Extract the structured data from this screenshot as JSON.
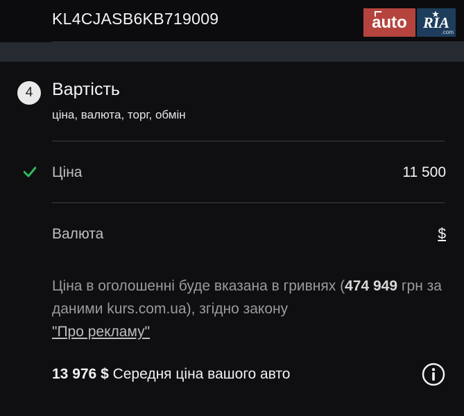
{
  "header": {
    "vin": "KL4CJASB6KB719009",
    "logo_auto": "auto",
    "logo_ria": "RIA",
    "logo_ria_sub": ".com"
  },
  "section": {
    "number": "4",
    "title": "Вартість",
    "subtitle": "ціна, валюта, торг, обмін"
  },
  "price": {
    "label": "Ціна",
    "value": "11 500",
    "completed": true
  },
  "currency": {
    "label": "Валюта",
    "value": "$"
  },
  "note": {
    "text_before": "Ціна в оголошенні буде вказана в гривнях (",
    "amount": "474 949",
    "text_middle": " грн за даними kurs.com.ua), згідно закону ",
    "link": "\"Про рекламу\""
  },
  "average": {
    "amount": "13 976 $",
    "label": " Середня ціна вашого авто"
  },
  "colors": {
    "accent_check": "#2ebd59",
    "auto_brand": "#b5443e",
    "ria_brand": "#1e3d5c"
  }
}
